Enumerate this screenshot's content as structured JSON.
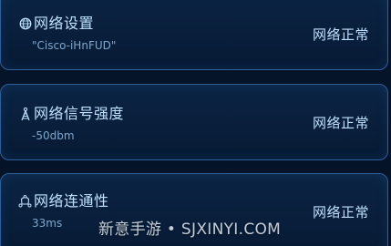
{
  "cards": [
    {
      "title": "网络设置",
      "icon": "globe-icon",
      "value": "\"Cisco-iHnFUD\"",
      "status": "网络正常"
    },
    {
      "title": "网络信号强度",
      "icon": "signal-tower-icon",
      "value": "-50dbm",
      "status": "网络正常"
    },
    {
      "title": "网络连通性",
      "icon": "connectivity-icon",
      "value": "33ms",
      "status": "网络正常"
    }
  ],
  "watermark": "新意手游 • SJXINYI.COM",
  "colors": {
    "background": "#061428",
    "card_border": "#2f5f98",
    "title_text": "#bfe0ff",
    "value_text": "#7fa6cc"
  }
}
